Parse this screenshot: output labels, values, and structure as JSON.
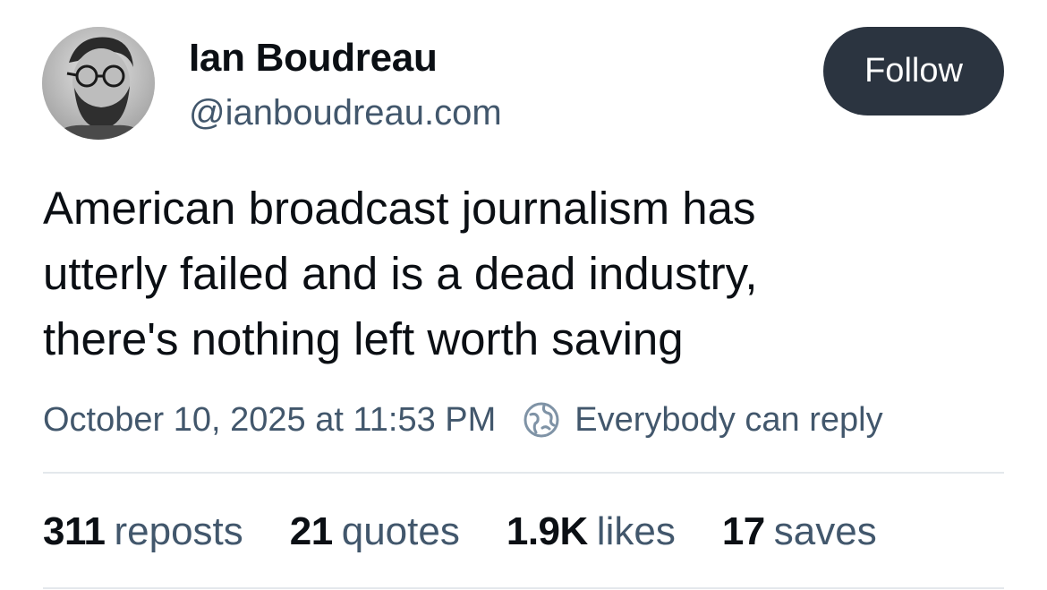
{
  "author": {
    "display_name": "Ian Boudreau",
    "handle": "@ianboudreau.com"
  },
  "follow_label": "Follow",
  "post": {
    "lines": [
      "American broadcast journalism has",
      "utterly failed and is a dead industry,",
      "there's nothing left worth saving"
    ],
    "timestamp": "October 10, 2025 at 11:53 PM",
    "reply_setting": "Everybody can reply"
  },
  "stats": {
    "reposts": {
      "value": "311",
      "label": "reposts"
    },
    "quotes": {
      "value": "21",
      "label": "quotes"
    },
    "likes": {
      "value": "1.9K",
      "label": "likes"
    },
    "saves": {
      "value": "17",
      "label": "saves"
    }
  },
  "icons": {
    "globe": "globe-icon"
  },
  "colors": {
    "follow_button_bg": "#2b3440",
    "secondary_text": "#42576c",
    "primary_text": "#0b0f14",
    "divider": "#e4e8ec"
  }
}
